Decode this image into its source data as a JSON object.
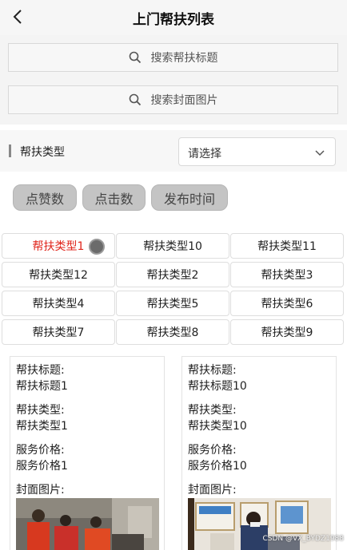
{
  "header": {
    "title": "上门帮扶列表",
    "back_icon": "back-arrow-icon"
  },
  "search": [
    {
      "placeholder": "搜索帮扶标题",
      "icon": "search-icon"
    },
    {
      "placeholder": "搜索封面图片",
      "icon": "search-icon"
    }
  ],
  "filter": {
    "label": "帮扶类型",
    "select_value": "请选择",
    "chevron_icon": "chevron-down-icon"
  },
  "sort_buttons": [
    "点赞数",
    "点击数",
    "发布时间"
  ],
  "type_grid": {
    "active_color": "#e0261c",
    "items": [
      "帮扶类型1",
      "帮扶类型10",
      "帮扶类型11",
      "帮扶类型12",
      "帮扶类型2",
      "帮扶类型3",
      "帮扶类型4",
      "帮扶类型5",
      "帮扶类型6",
      "帮扶类型7",
      "帮扶类型8",
      "帮扶类型9"
    ]
  },
  "cards": [
    {
      "title_label": "帮扶标题:",
      "title_value": "帮扶标题1",
      "type_label": "帮扶类型:",
      "type_value": "帮扶类型1",
      "price_label": "服务价格:",
      "price_value": "服务价格1",
      "image_label": "封面图片:"
    },
    {
      "title_label": "帮扶标题:",
      "title_value": "帮扶标题10",
      "type_label": "帮扶类型:",
      "type_value": "帮扶类型10",
      "price_label": "服务价格:",
      "price_value": "服务价格10",
      "image_label": "封面图片:"
    }
  ],
  "watermark": "CSDN @VX_BYDZ1988"
}
